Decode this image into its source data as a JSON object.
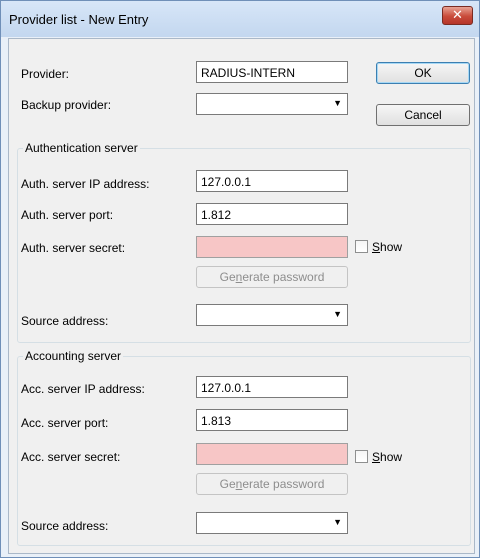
{
  "window": {
    "title": "Provider list - New Entry",
    "close_glyph": "✕"
  },
  "provider": {
    "label": "Provider:",
    "value": "RADIUS-INTERN"
  },
  "backup": {
    "label": "Backup provider:",
    "value": ""
  },
  "buttons": {
    "ok": "OK",
    "cancel": "Cancel"
  },
  "auth": {
    "group_title": "Authentication server",
    "ip_label": "Auth. server IP address:",
    "ip_value": "127.0.0.1",
    "port_label": "Auth. server port:",
    "port_value": "1.812",
    "secret_label": "Auth. server secret:",
    "secret_value": "",
    "show_pre": "",
    "show_key": "S",
    "show_post": "how",
    "gen_pre": "Ge",
    "gen_key": "n",
    "gen_post": "erate password",
    "source_label": "Source address:",
    "source_value": ""
  },
  "acc": {
    "group_title": "Accounting server",
    "ip_label": "Acc. server IP address:",
    "ip_value": "127.0.0.1",
    "port_label": "Acc. server port:",
    "port_value": "1.813",
    "secret_label": "Acc. server secret:",
    "secret_value": "",
    "show_pre": "",
    "show_key": "S",
    "show_post": "how",
    "gen_pre": "Ge",
    "gen_key": "n",
    "gen_post": "erate password",
    "source_label": "Source address:",
    "source_value": ""
  },
  "colors": {
    "secret_bg": "#f7c6c6",
    "close_red": "#c94b3a",
    "titlebar": "#c3d7ef"
  },
  "icons": {
    "dropdown": "chevron-down-icon",
    "close": "close-icon"
  }
}
